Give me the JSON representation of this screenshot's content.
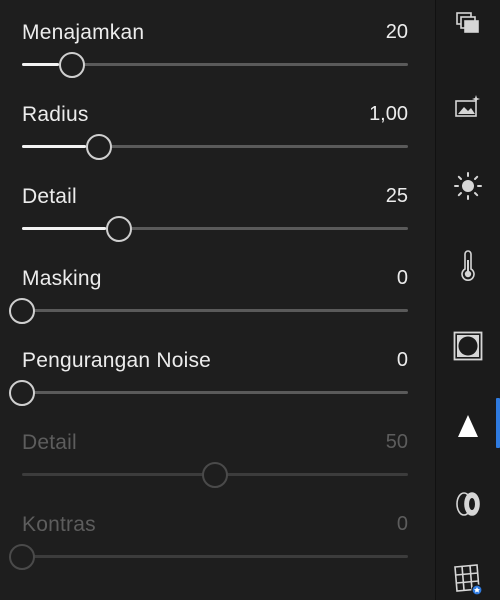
{
  "sliders": [
    {
      "id": "sharpen",
      "label": "Menajamkan",
      "value": "20",
      "level": 0.13,
      "disabled": false
    },
    {
      "id": "radius",
      "label": "Radius",
      "value": "1,00",
      "level": 0.2,
      "disabled": false
    },
    {
      "id": "detail",
      "label": "Detail",
      "value": "25",
      "level": 0.25,
      "disabled": false
    },
    {
      "id": "masking",
      "label": "Masking",
      "value": "0",
      "level": 0.0,
      "disabled": false
    },
    {
      "id": "noise-reduction",
      "label": "Pengurangan Noise",
      "value": "0",
      "level": 0.0,
      "disabled": false
    },
    {
      "id": "noise-detail",
      "label": "Detail",
      "value": "50",
      "level": 0.5,
      "disabled": true
    },
    {
      "id": "noise-contrast",
      "label": "Kontras",
      "value": "0",
      "level": 0.0,
      "disabled": true
    }
  ],
  "toolbar": {
    "tools": [
      {
        "name": "presets-icon"
      },
      {
        "name": "auto-enhance-icon"
      },
      {
        "name": "light-icon"
      },
      {
        "name": "color-temperature-icon"
      },
      {
        "name": "vignette-icon"
      },
      {
        "name": "detail-sharpen-icon",
        "active": true
      },
      {
        "name": "optics-icon"
      },
      {
        "name": "geometry-icon"
      }
    ],
    "accent_color": "#2f7be0"
  }
}
